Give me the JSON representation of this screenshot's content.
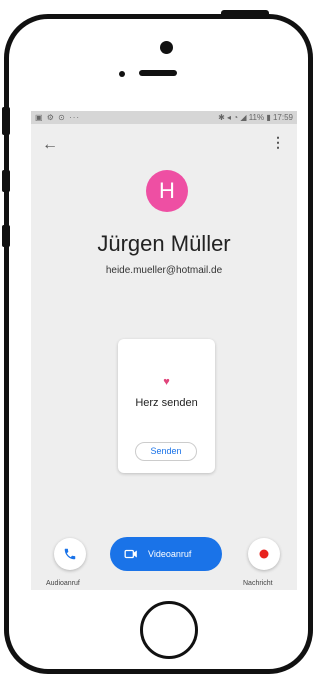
{
  "status_bar": {
    "left_icons": "▣ ⚙ ⊙ ···",
    "right": "✱ ◂ ◔ ◢ 11% ▮ 17:59"
  },
  "contact": {
    "initial": "H",
    "name": "Jürgen Müller",
    "email": "heide.mueller@hotmail.de",
    "avatar_color": "#ee4fa3"
  },
  "card": {
    "title": "Herz senden",
    "button": "Senden"
  },
  "actions": {
    "audio_label": "Audioanruf",
    "video_label": "Videoanruf",
    "message_label": "Nachricht"
  },
  "colors": {
    "accent": "#1a73e8",
    "record": "#e8221d"
  },
  "icons": {
    "back": "arrow-left-icon",
    "menu": "more-vertical-icon",
    "phone": "phone-icon",
    "video": "video-camera-icon",
    "record": "record-dot-icon",
    "heart": "heart-icon"
  }
}
